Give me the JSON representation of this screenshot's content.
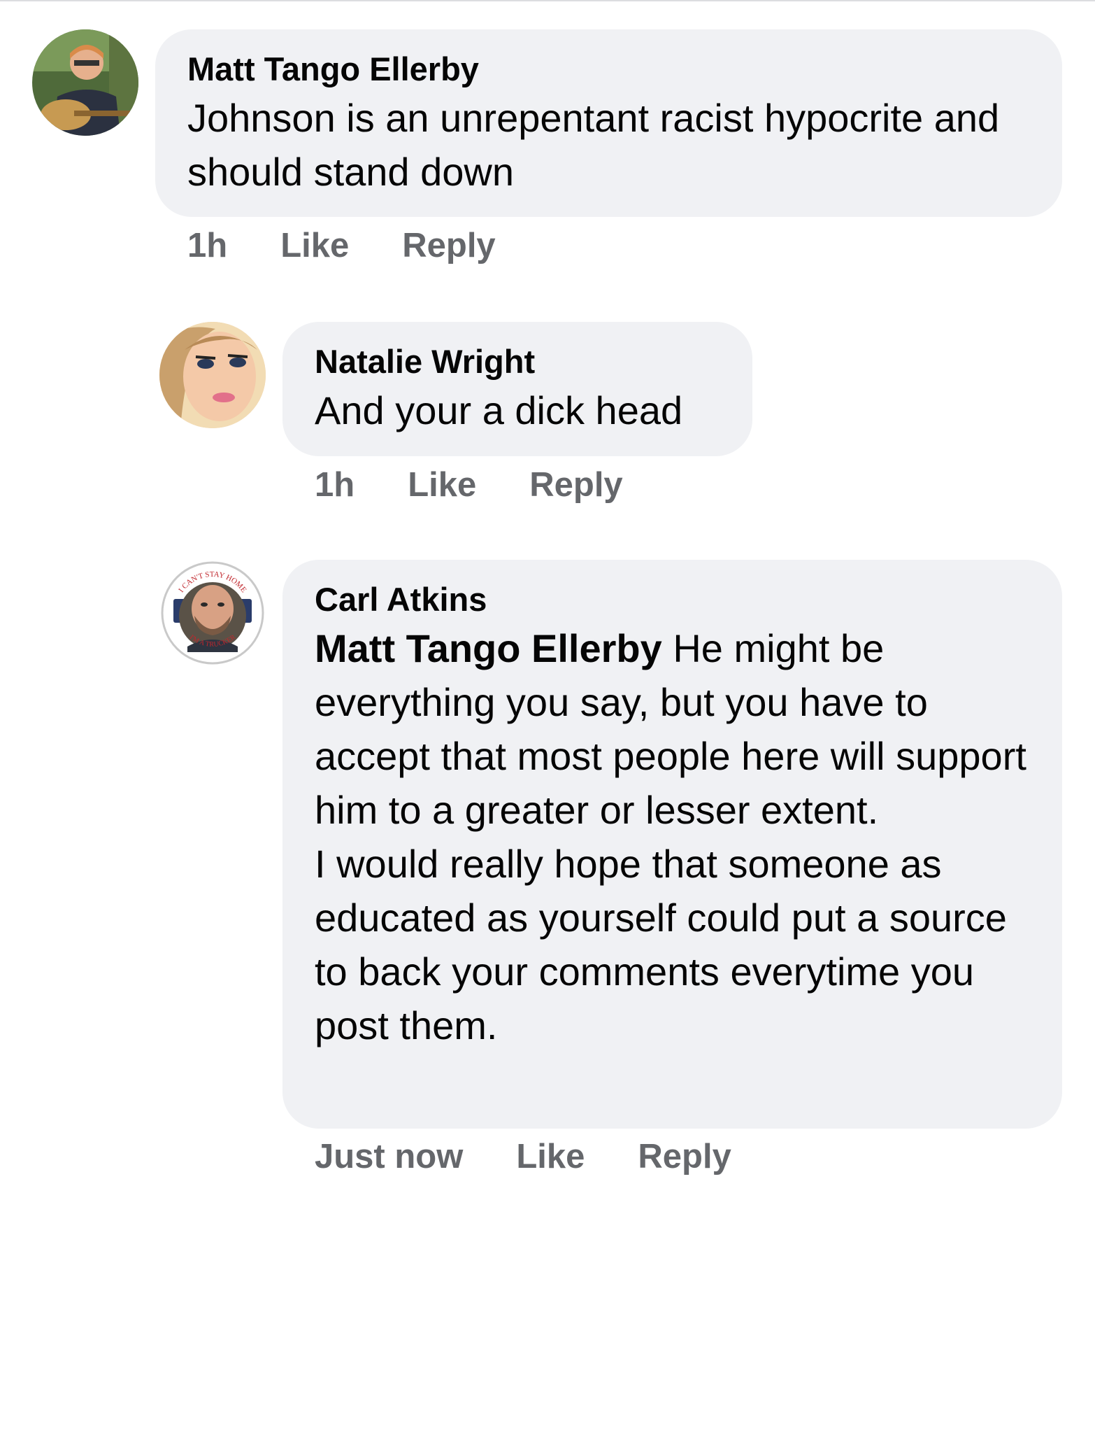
{
  "comments": [
    {
      "author": "Matt Tango Ellerby",
      "paragraphs": [
        "Johnson is an unrepentant racist hypocrite and should stand down"
      ],
      "time": "1h",
      "like": "Like",
      "reply": "Reply"
    },
    {
      "author": "Natalie Wright",
      "paragraphs": [
        "And your a dick head"
      ],
      "time": "1h",
      "like": "Like",
      "reply": "Reply"
    },
    {
      "author": "Carl Atkins",
      "mention": "Matt Tango Ellerby",
      "paragraphs": [
        "He might be everything you say, but you have to accept that most people here will support him to a greater or lesser extent.",
        "I would really hope that someone as educated as yourself could put a source to back your comments everytime you post them."
      ],
      "time": "Just now",
      "like": "Like",
      "reply": "Reply"
    }
  ],
  "colors": {
    "bubble": "#f0f1f4",
    "text": "#050505",
    "meta": "#65676b"
  },
  "avatar_badge": {
    "top": "I CAN'T STAY HOME",
    "bottom": "I'M A TRUCKER"
  }
}
